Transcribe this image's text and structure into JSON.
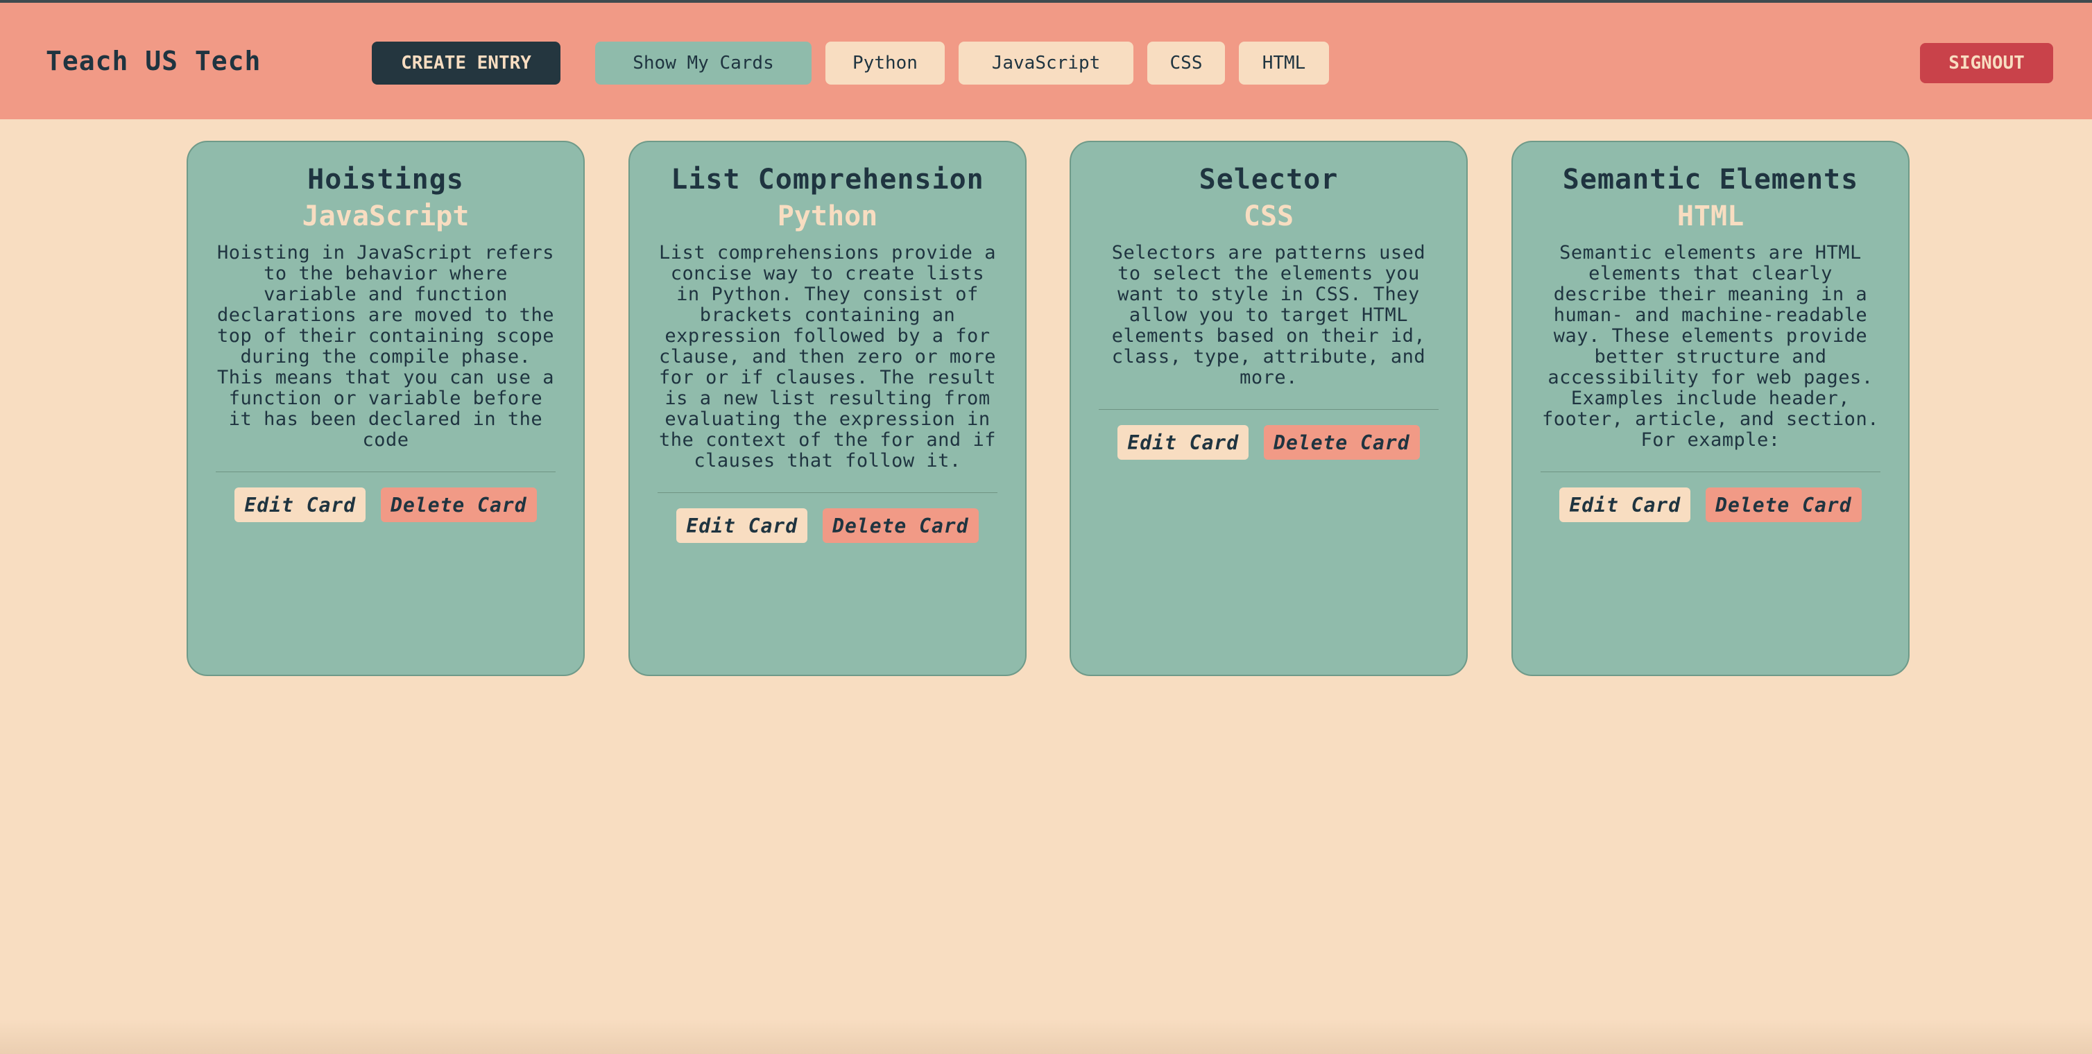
{
  "header": {
    "brand": "Teach US Tech",
    "create_label": "CREATE ENTRY",
    "show_label": "Show My Cards",
    "filters": [
      "Python",
      "JavaScript",
      "CSS",
      "HTML"
    ],
    "signout_label": "SIGNOUT"
  },
  "cards": [
    {
      "title": "Hoistings",
      "language": "JavaScript",
      "body": "Hoisting in JavaScript refers to the behavior where variable and function declarations are moved to the top of their containing scope during the compile phase. This means that you can use a function or variable before it has been declared in the code",
      "edit_label": "Edit Card",
      "delete_label": "Delete Card"
    },
    {
      "title": "List Comprehension",
      "language": "Python",
      "body": "List comprehensions provide a concise way to create lists in Python. They consist of brackets containing an expression followed by a for clause, and then zero or more for or if clauses. The result is a new list resulting from evaluating the expression in the context of the for and if clauses that follow it.",
      "edit_label": "Edit Card",
      "delete_label": "Delete Card"
    },
    {
      "title": "Selector",
      "language": "CSS",
      "body": "Selectors are patterns used to select the elements you want to style in CSS. They allow you to target HTML elements based on their id, class, type, attribute, and more.",
      "edit_label": "Edit Card",
      "delete_label": "Delete Card"
    },
    {
      "title": "Semantic Elements",
      "language": "HTML",
      "body": "Semantic elements are HTML elements that clearly describe their meaning in a human- and machine-readable way. These elements provide better structure and accessibility for web pages. Examples include header, footer, article, and section. For example:",
      "edit_label": "Edit Card",
      "delete_label": "Delete Card"
    }
  ],
  "colors": {
    "page_bg": "#f8ddc1",
    "navbar_bg": "#f19a86",
    "card_bg": "#90bbab",
    "dark": "#1f3440",
    "signout": "#c9424a"
  }
}
